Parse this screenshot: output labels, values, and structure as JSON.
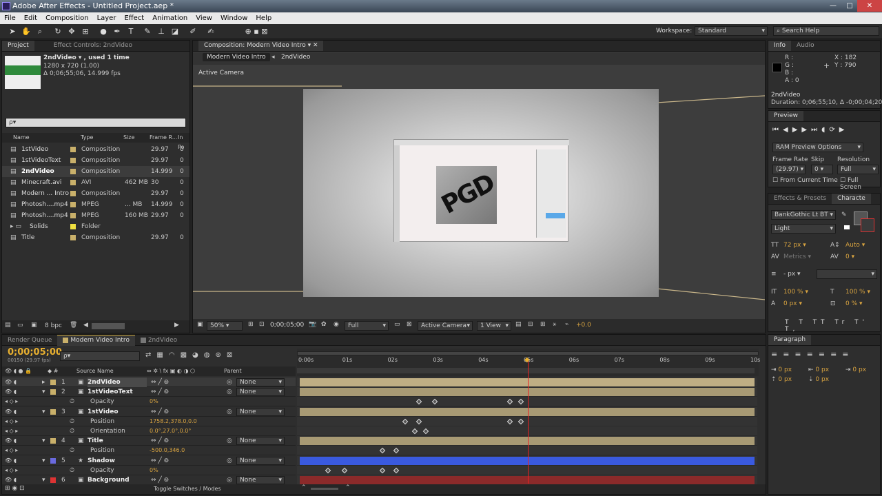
{
  "window": {
    "title": "Adobe After Effects - Untitled Project.aep *",
    "min": "—",
    "max": "□",
    "close": "✕"
  },
  "menu": [
    "File",
    "Edit",
    "Composition",
    "Layer",
    "Effect",
    "Animation",
    "View",
    "Window",
    "Help"
  ],
  "toolbar": {
    "workspace_label": "Workspace:",
    "workspace_value": "Standard",
    "search_placeholder": "Search Help"
  },
  "project": {
    "tab": "Project",
    "tab2": "Effect Controls: 2ndVideo",
    "item_name": "2ndVideo ▾ , used 1 time",
    "item_dims": "1280 x 720 (1.00)",
    "item_dur": "Δ 0;06;55;06, 14.999 fps",
    "search": "ρ▾",
    "columns": [
      "Name",
      "Type",
      "Size",
      "Frame R...",
      "In Po"
    ],
    "items": [
      {
        "name": "1stVideo",
        "color": "#c9b06a",
        "type": "Composition",
        "size": "",
        "fps": "29.97",
        "in": "0"
      },
      {
        "name": "1stVideoText",
        "color": "#c9b06a",
        "type": "Composition",
        "size": "",
        "fps": "29.97",
        "in": "0"
      },
      {
        "name": "2ndVideo",
        "color": "#c9b06a",
        "type": "Composition",
        "size": "",
        "fps": "14.999",
        "in": "0"
      },
      {
        "name": "Minecraft.avi",
        "color": "#c9b06a",
        "type": "AVI",
        "size": "462 MB",
        "fps": "30",
        "in": "0"
      },
      {
        "name": "Modern ... Intro",
        "color": "#c9b06a",
        "type": "Composition",
        "size": "",
        "fps": "29.97",
        "in": "0"
      },
      {
        "name": "Photosh....mp4",
        "color": "#c9b06a",
        "type": "MPEG",
        "size": "... MB",
        "fps": "14.999",
        "in": "0"
      },
      {
        "name": "Photosh....mp4",
        "color": "#c9b06a",
        "type": "MPEG",
        "size": "160 MB",
        "fps": "29.97",
        "in": "0"
      },
      {
        "name": "Solids",
        "color": "#f0e040",
        "type": "Folder",
        "size": "",
        "fps": "",
        "in": ""
      },
      {
        "name": "Title",
        "color": "#c9b06a",
        "type": "Composition",
        "size": "",
        "fps": "29.97",
        "in": "0"
      }
    ],
    "bpc": "8 bpc"
  },
  "comp": {
    "tab": "Composition: Modern Video Intro",
    "crumb1": "Modern Video Intro",
    "crumb2": "2ndVideo",
    "camera": "Active Camera",
    "zoom": "50%",
    "timecode": "0;00;05;00",
    "res": "Full",
    "view_cam": "Active Camera",
    "views": "1 View",
    "exposure": "+0.0",
    "logo": "PGD"
  },
  "info": {
    "tab": "Info",
    "tab2": "Audio",
    "r": "R :",
    "g": "G :",
    "b": "B :",
    "a": "A : 0",
    "x": "X : 182",
    "y": "Y : 790",
    "name": "2ndVideo",
    "duration": "Duration: 0;06;55;10, Δ -0;00;04;20"
  },
  "preview": {
    "tab": "Preview",
    "ram": "RAM Preview Options",
    "fr_label": "Frame Rate",
    "skip_label": "Skip",
    "res_label": "Resolution",
    "fr": "(29.97)",
    "skip": "0",
    "res": "Full",
    "from_current": "From Current Time",
    "full_screen": "Full Screen"
  },
  "character": {
    "tab1": "Effects & Presets",
    "tab2": "Characte",
    "font": "BankGothic Lt BT",
    "style": "Light",
    "size": "72 px",
    "leading": "Auto",
    "kerning": "Metrics",
    "tracking": "0",
    "stroke": "- px",
    "vscale": "100 %",
    "hscale": "100 %",
    "baseline": "0 px",
    "tsume": "0 %",
    "styles": "T T TT Tr T' T,"
  },
  "paragraph": {
    "tab": "Paragraph",
    "v1": "0 px",
    "v2": "0 px",
    "v3": "0 px",
    "v4": "0 px",
    "v5": "0 px"
  },
  "timeline": {
    "tab1": "Render Queue",
    "tab2": "Modern Video Intro",
    "tab3": "2ndVideo",
    "timecode": "0;00;05;00",
    "frame": "00150 (29.97 fps)",
    "search": "ρ▾",
    "col_source": "Source Name",
    "col_parent": "Parent",
    "toggle": "Toggle Switches / Modes",
    "ticks": [
      "0:00s",
      "01s",
      "02s",
      "03s",
      "04s",
      "05s",
      "06s",
      "07s",
      "08s",
      "09s",
      "10s"
    ],
    "layers": [
      {
        "num": "1",
        "name": "2ndVideo",
        "parent": "None",
        "kind": "layer",
        "bar": "#bfae84",
        "selected": true
      },
      {
        "num": "2",
        "name": "1stVideoText",
        "parent": "None",
        "kind": "layer",
        "bar": "#a89a74"
      },
      {
        "num": "",
        "name": "Opacity",
        "value": "0%",
        "kind": "prop",
        "keys": [
          2.6,
          2.95,
          4.6,
          4.85
        ]
      },
      {
        "num": "3",
        "name": "1stVideo",
        "parent": "None",
        "kind": "layer",
        "bar": "#a89a74"
      },
      {
        "num": "",
        "name": "Position",
        "value": "1758.2,378.0,0.0",
        "kind": "prop",
        "keys": [
          2.3,
          2.6,
          4.6,
          4.85
        ]
      },
      {
        "num": "",
        "name": "Orientation",
        "value": "0.0°,27.0°,0.0°",
        "kind": "prop",
        "keys": [
          2.5,
          2.75
        ]
      },
      {
        "num": "4",
        "name": "Title",
        "parent": "None",
        "kind": "layer",
        "bar": "#a89a74"
      },
      {
        "num": "",
        "name": "Position",
        "value": "-500.0,346.0",
        "kind": "prop",
        "keys": [
          1.8,
          2.1
        ]
      },
      {
        "num": "5",
        "name": "Shadow",
        "parent": "None",
        "kind": "layer",
        "bar": "#3a5adf"
      },
      {
        "num": "",
        "name": "Opacity",
        "value": "0%",
        "kind": "prop",
        "keys": [
          0.6,
          0.95,
          1.8,
          2.1
        ]
      },
      {
        "num": "6",
        "name": "Background",
        "parent": "None",
        "kind": "layer",
        "bar": "#8b2a2a"
      }
    ]
  }
}
